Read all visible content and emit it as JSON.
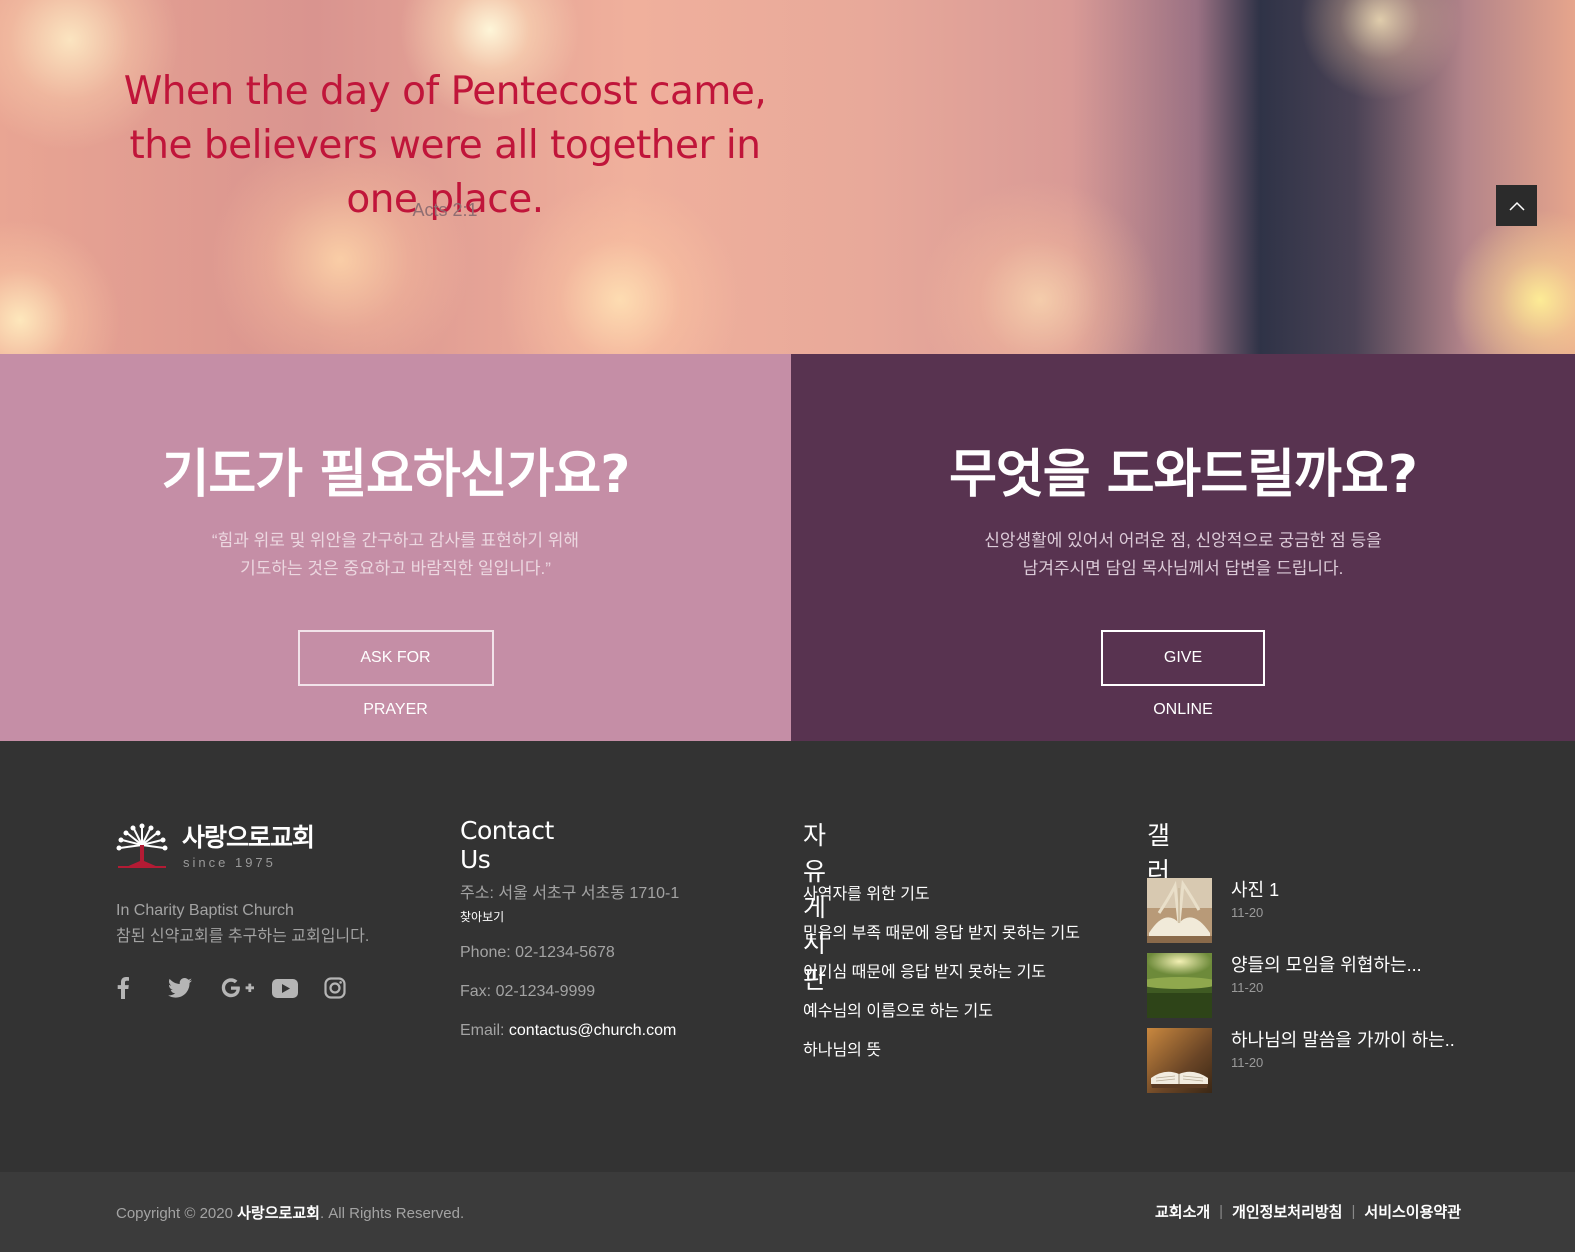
{
  "hero": {
    "quote": "When the day of Pentecost came, the believers were all together in one place.",
    "reference": "Acts 2:1"
  },
  "prayer": {
    "title": "기도가 필요하신가요?",
    "desc_line1": "“힘과 위로 및 위안을 간구하고 감사를 표현하기 위해",
    "desc_line2": "기도하는 것은 중요하고 바람직한 일입니다.”",
    "button": "ASK FOR PRAYER"
  },
  "help": {
    "title": "무엇을 도와드릴까요?",
    "desc_line1": "신앙생활에 있어서 어려운 점, 신앙적으로 궁금한 점 등을",
    "desc_line2": "남겨주시면 담임 목사님께서 답변을 드립니다.",
    "button": "GIVE ONLINE"
  },
  "footer": {
    "logo_name": "사랑으로교회",
    "logo_since": "since 1975",
    "about_line1": "In Charity Baptist Church",
    "about_line2": "참된 신약교회를 추구하는 교회입니다.",
    "social": [
      "facebook-icon",
      "twitter-icon",
      "google-plus-icon",
      "youtube-icon",
      "instagram-icon"
    ],
    "contact": {
      "title": "Contact Us",
      "address": "주소: 서울 서초구 서초동 1710-1",
      "map_link": "찾아보기",
      "phone": "Phone: 02-1234-5678",
      "fax": "Fax: 02-1234-9999",
      "email_label": "Email: ",
      "email": "contactus@church.com"
    },
    "board": {
      "title": "자유게시판",
      "items": [
        "사역자를 위한 기도",
        "믿음의 부족 때문에 응답 받지 못하는 기도",
        "이기심 때문에 응답 받지 못하는 기도",
        "예수님의 이름으로 하는 기도",
        "하나님의 뜻"
      ]
    },
    "gallery": {
      "title": "갤러리",
      "items": [
        {
          "title": "사진 1",
          "date": "11-20"
        },
        {
          "title": "양들의 모임을 위협하는...",
          "date": "11-20"
        },
        {
          "title": "하나님의 말씀을 가까이 하는..",
          "date": "11-20"
        }
      ]
    }
  },
  "bottom": {
    "copyright_prefix": "Copyright © 2020 ",
    "copyright_name": "사랑으로교회",
    "copyright_suffix": ". All Rights Reserved.",
    "links": [
      "교회소개",
      "개인정보처리방침",
      "서비스이용약관"
    ]
  },
  "colors": {
    "quote": "#c0153a",
    "panel_left": "#c58ea6",
    "panel_right": "#583350",
    "footer": "#333333",
    "bottom_bar": "#3b3b3b"
  }
}
